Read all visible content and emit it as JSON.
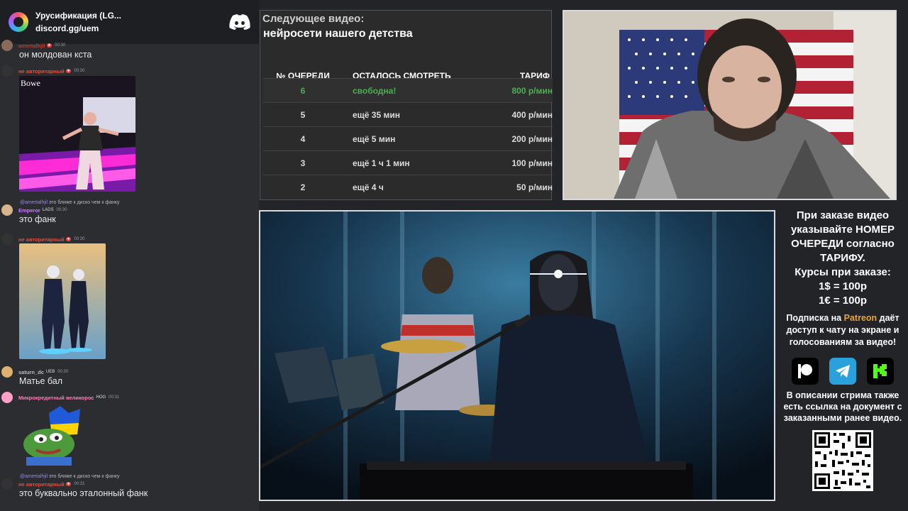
{
  "chat": {
    "server_name": "Урусификация (LG...",
    "invite": "discord.gg/uem",
    "messages": [
      {
        "user": "amertalhjil",
        "time": "00:30",
        "text": "он молдован кста"
      },
      {
        "user": "не авторитарный",
        "time": "00:30",
        "image_caption": "Bowe"
      },
      {
        "reply_user": "@amertalhjil",
        "reply_text": "это ближе к диско чем к фанку",
        "user": "Emperor",
        "tag": "LADS",
        "time": "00:30",
        "text": "это фанк"
      },
      {
        "user": "не авторитарный",
        "time": "00:30"
      },
      {
        "user": "saturn_dc",
        "tag": "UEB",
        "time": "00:30",
        "text": "Матье бал"
      },
      {
        "user": "Микрокредитный великорос",
        "tag": "HOG",
        "time": "00:31"
      },
      {
        "reply_user": "@amertalhjil",
        "reply_text": "это ближе к диско чем к фанку",
        "user": "не авторитарный",
        "time": "00:31",
        "text": "это буквально эталонный фанк"
      }
    ]
  },
  "queue": {
    "next_label": "Следующее видео:",
    "next_title": "нейросети нашего детства",
    "headers": [
      "№ ОЧЕРЕДИ",
      "ОСТАЛОСЬ СМОТРЕТЬ",
      "ТАРИФ"
    ],
    "rows": [
      {
        "num": "6",
        "remaining": "свободна!",
        "rate": "800 р/мин"
      },
      {
        "num": "5",
        "remaining": "ещё 35 мин",
        "rate": "400 р/мин"
      },
      {
        "num": "4",
        "remaining": "ещё 5 мин",
        "rate": "200 р/мин"
      },
      {
        "num": "3",
        "remaining": "ещё 1 ч 1 мин",
        "rate": "100 р/мин"
      },
      {
        "num": "2",
        "remaining": "ещё 4 ч",
        "rate": "50 р/мин"
      }
    ],
    "highlight_color": "#4caf50"
  },
  "info": {
    "order_text": "При заказе видео указывайте НОМЕР ОЧЕРЕДИ согласно ТАРИФУ.",
    "rates_title": "Курсы при заказе:",
    "rate_usd": "1$ = 100р",
    "rate_eur": "1€ = 100р",
    "sub_pre": "Подписка на",
    "sub_link": "Patreon",
    "sub_post": "даёт доступ к чату на экране и голосованиям за видео!",
    "desc": "В описании стрима также есть ссылка на документ с заказанными ранее видео.",
    "social_icons": [
      "patreon-icon",
      "telegram-icon",
      "kick-icon"
    ]
  }
}
